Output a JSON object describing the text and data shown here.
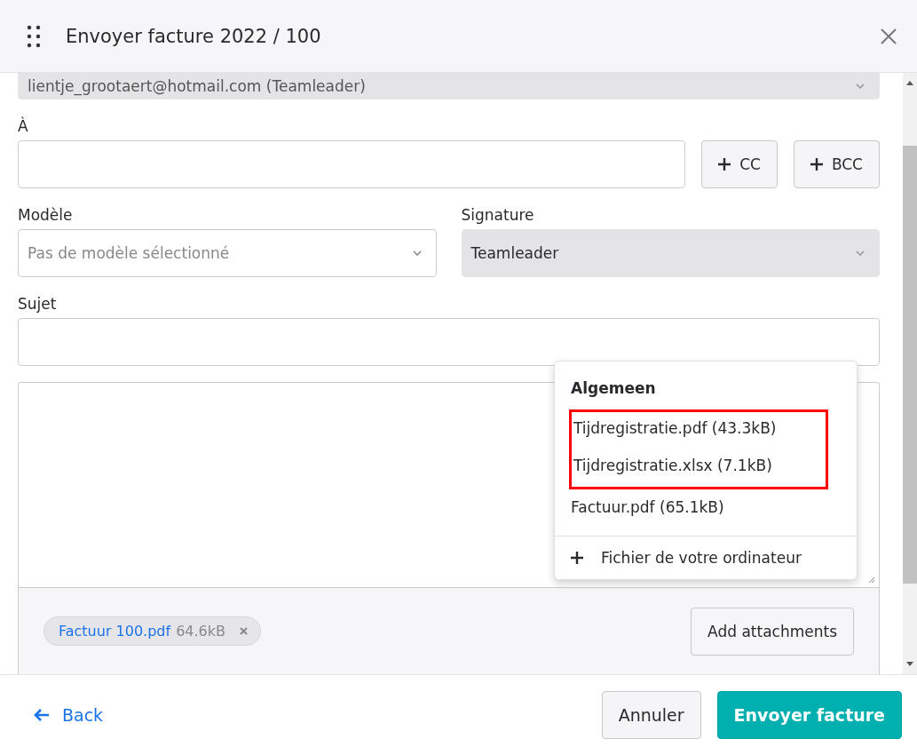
{
  "dialog": {
    "title": "Envoyer facture 2022 / 100"
  },
  "sender": {
    "value": "lientje_grootaert@hotmail.com (Teamleader)"
  },
  "to": {
    "label": "À",
    "buttons": [
      "CC",
      "BCC"
    ]
  },
  "template": {
    "label": "Modèle",
    "placeholder": "Pas de modèle sélectionné"
  },
  "signature": {
    "label": "Signature",
    "value": "Teamleader"
  },
  "subject": {
    "label": "Sujet"
  },
  "attachments": [
    {
      "name": "Factuur 100.pdf",
      "size": "64.6kB"
    }
  ],
  "add_button": "Add attachments",
  "menu": {
    "heading": "Algemeen",
    "items": [
      {
        "label": "Tijdregistratie.pdf (43.3kB)",
        "highlighted": true
      },
      {
        "label": "Tijdregistratie.xlsx (7.1kB)",
        "highlighted": true
      },
      {
        "label": "Factuur.pdf (65.1kB)",
        "highlighted": false
      }
    ],
    "upload": "Fichier de votre ordinateur"
  },
  "footer": {
    "back": "Back",
    "cancel": "Annuler",
    "submit": "Envoyer facture"
  }
}
